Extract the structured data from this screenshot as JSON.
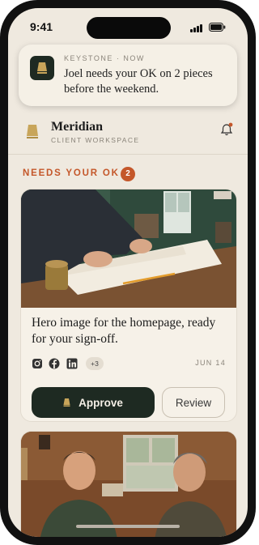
{
  "status_bar": {
    "time": "9:41"
  },
  "notification": {
    "app": "KEYSTONE",
    "separator": "·",
    "when": "NOW",
    "message": "Joel needs your OK on 2 pieces before the weekend."
  },
  "header": {
    "brand": "Meridian",
    "subtitle": "CLIENT WORKSPACE"
  },
  "section": {
    "title": "NEEDS YOUR OK",
    "count": "2"
  },
  "cards": [
    {
      "caption": "Hero image for the homepage, ready for your sign-off.",
      "channels": [
        "instagram-icon",
        "facebook-icon",
        "linkedin-icon"
      ],
      "more": "+3",
      "date": "JUN 14",
      "approve_label": "Approve",
      "review_label": "Review"
    }
  ],
  "colors": {
    "accent": "#c4572a",
    "primary": "#1e2a22",
    "background": "#efe9df"
  }
}
